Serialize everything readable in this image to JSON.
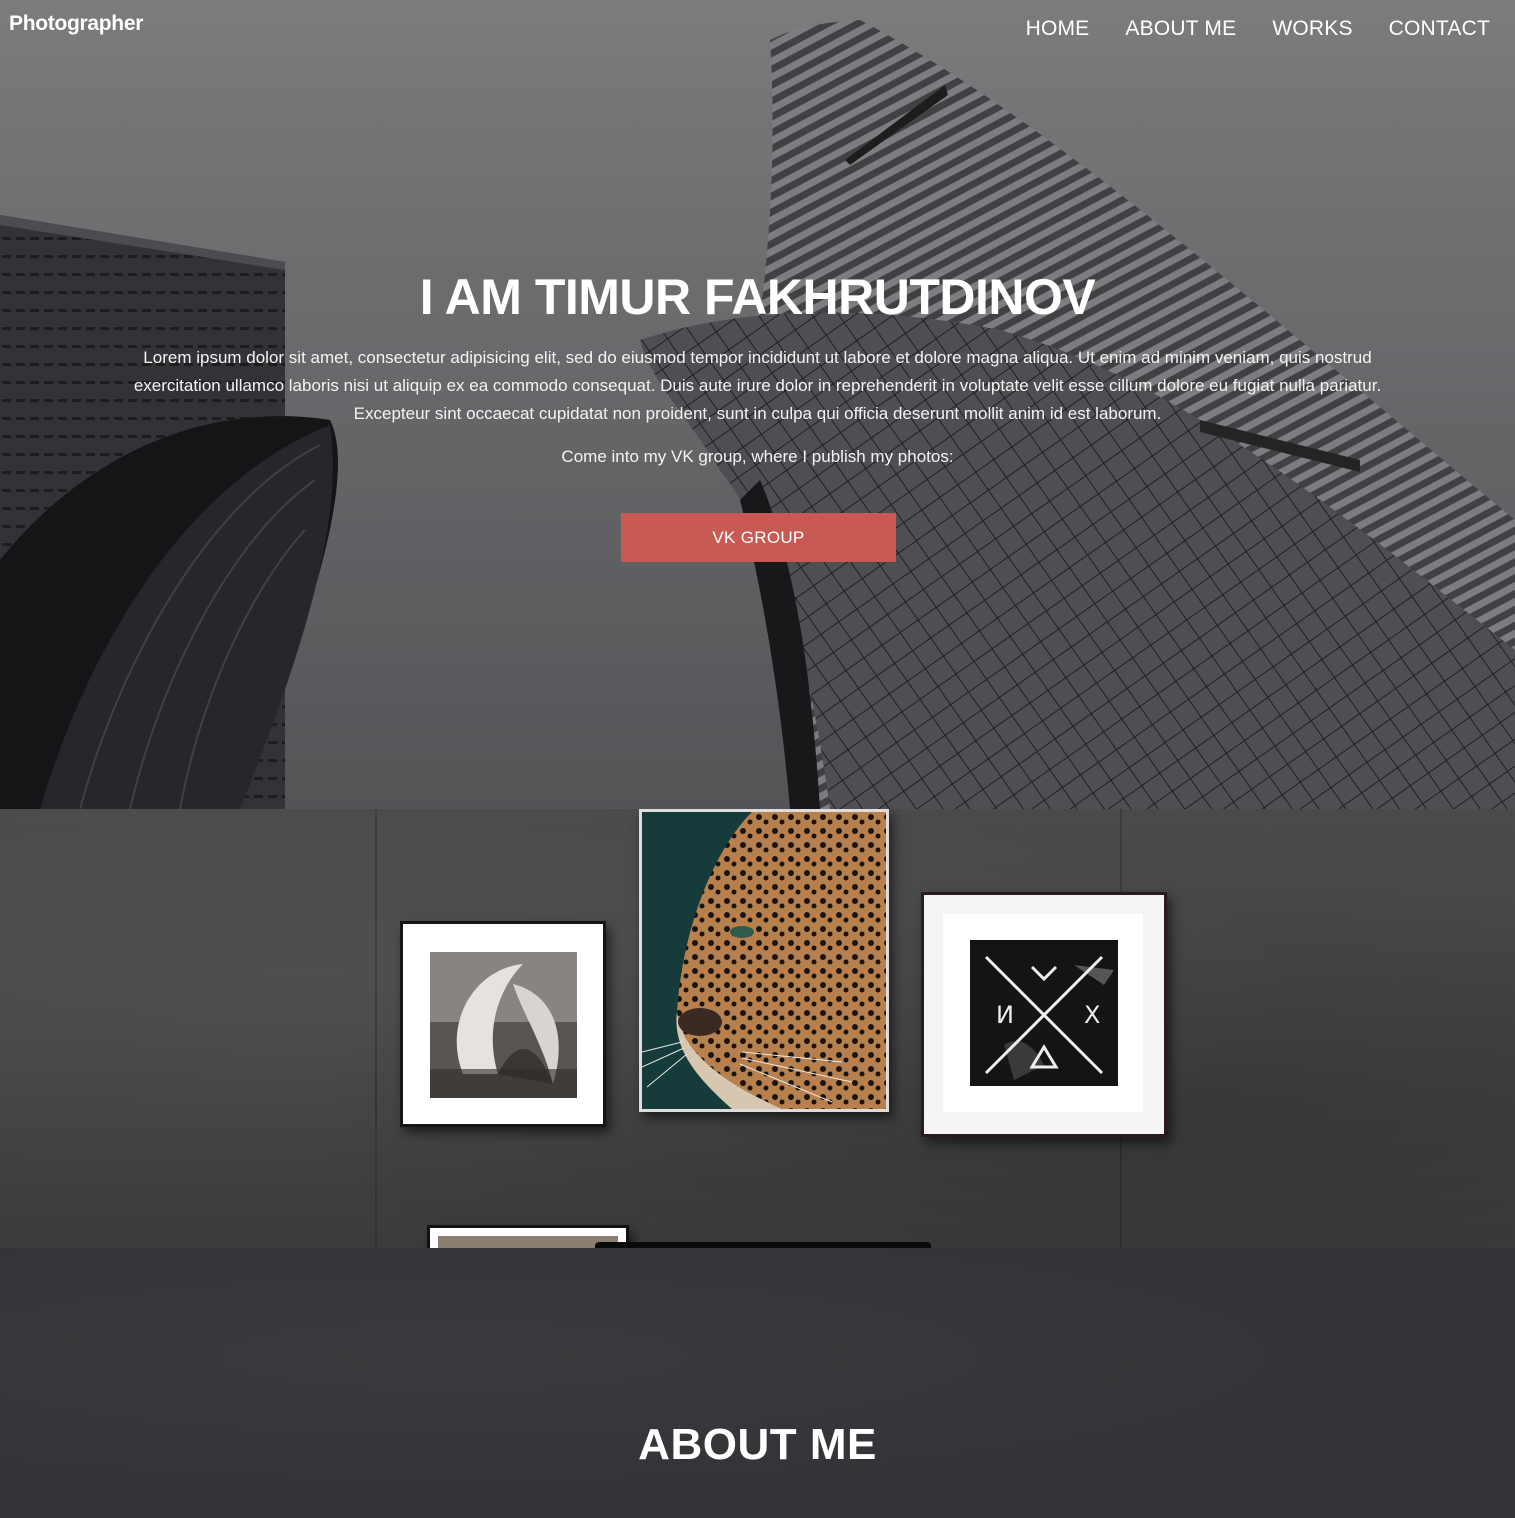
{
  "header": {
    "brand": "Photographer",
    "nav": [
      "HOME",
      "ABOUT ME",
      "WORKS",
      "CONTACT"
    ]
  },
  "hero": {
    "title": "I AM TIMUR FAKHRUTDINOV",
    "text": "Lorem ipsum dolor sit amet, consectetur adipisicing elit, sed do eiusmod tempor incididunt ut labore et dolore magna aliqua. Ut enim ad minim veniam, quis nostrud exercitation ullamco laboris nisi ut aliquip ex ea commodo consequat. Duis aute irure dolor in reprehenderit in voluptate velit esse cillum dolore eu fugiat nulla pariatur. Excepteur sint occaecat cupidatat non proident, sunt in culpa qui officia deserunt mollit anim id est laborum.",
    "cta_text": "Come into my VK group, where I publish my photos:",
    "button_label": "VK GROUP"
  },
  "about": {
    "title": "ABOUT ME"
  },
  "colors": {
    "accent": "#c95953",
    "footer_bg": "#323437"
  }
}
